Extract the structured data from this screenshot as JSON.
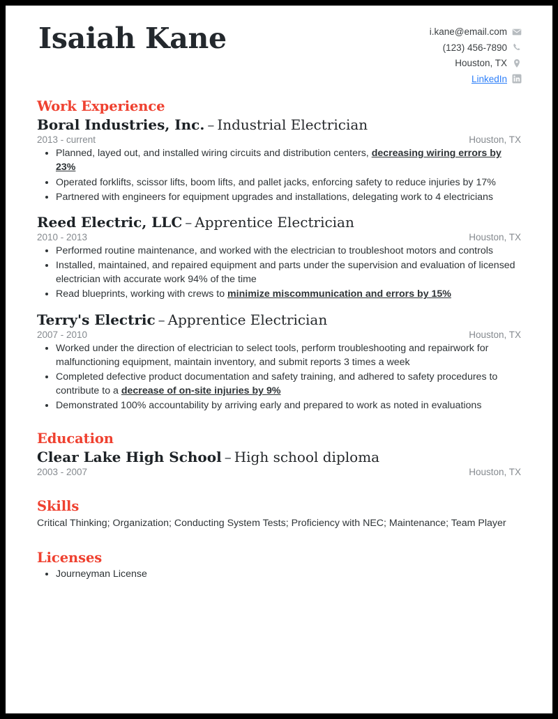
{
  "profile": {
    "name": "Isaiah Kane",
    "contact": [
      {
        "text": "i.kane@email.com",
        "icon": "envelope-icon",
        "link": false
      },
      {
        "text": "(123) 456-7890",
        "icon": "phone-icon",
        "link": false
      },
      {
        "text": "Houston, TX",
        "icon": "location-pin-icon",
        "link": false
      },
      {
        "text": "LinkedIn",
        "icon": "linkedin-icon",
        "link": true
      }
    ]
  },
  "colors": {
    "accent": "#ef4130",
    "link": "#2d7ff9",
    "heading": "#23282d",
    "body": "#2f3437",
    "muted": "#858a8f",
    "border": "#000000"
  },
  "sections": {
    "work": {
      "title": "Work Experience",
      "entries": [
        {
          "org": "Boral Industries, Inc.",
          "separator": "–",
          "role": "Industrial Electrician",
          "dates": "2013 - current",
          "location": "Houston, TX",
          "bullets": [
            {
              "pre": "Planned, layed out, and installed wiring circuits and distribution centers, ",
              "hl": "decreasing wiring errors by 23%",
              "post": ""
            },
            {
              "pre": "Operated forklifts, scissor lifts, boom lifts, and pallet jacks, enforcing safety to reduce injuries by 17%",
              "hl": "",
              "post": ""
            },
            {
              "pre": "Partnered with engineers for equipment upgrades and installations, delegating work to 4 electricians",
              "hl": "",
              "post": ""
            }
          ]
        },
        {
          "org": "Reed Electric, LLC",
          "separator": "–",
          "role": "Apprentice Electrician",
          "dates": "2010 - 2013",
          "location": "Houston, TX",
          "bullets": [
            {
              "pre": "Performed routine maintenance, and worked with the electrician to troubleshoot motors and controls",
              "hl": "",
              "post": ""
            },
            {
              "pre": "Installed, maintained, and repaired equipment and parts under the supervision and evaluation of licensed electrician with accurate work 94% of the time",
              "hl": "",
              "post": ""
            },
            {
              "pre": "Read blueprints, working with crews to ",
              "hl": "minimize miscommunication and errors by 15%",
              "post": ""
            }
          ]
        },
        {
          "org": "Terry's Electric",
          "separator": "–",
          "role": "Apprentice Electrician",
          "dates": "2007 - 2010",
          "location": "Houston, TX",
          "bullets": [
            {
              "pre": "Worked under the direction of electrician to select tools, perform troubleshooting and repairwork for malfunctioning equipment, maintain inventory, and submit reports 3 times a week",
              "hl": "",
              "post": ""
            },
            {
              "pre": "Completed defective product documentation and safety training, and adhered to safety procedures to contribute to a ",
              "hl": "decrease of on-site injuries by 9%",
              "post": ""
            },
            {
              "pre": "Demonstrated 100% accountability by arriving early and prepared to work as noted in evaluations",
              "hl": "",
              "post": ""
            }
          ]
        }
      ]
    },
    "education": {
      "title": "Education",
      "entries": [
        {
          "org": "Clear Lake High School",
          "separator": "–",
          "role": "High school diploma",
          "dates": "2003 - 2007",
          "location": "Houston, TX"
        }
      ]
    },
    "skills": {
      "title": "Skills",
      "text": "Critical Thinking; Organization; Conducting System Tests; Proficiency with NEC; Maintenance; Team Player"
    },
    "licenses": {
      "title": "Licenses",
      "items": [
        "Journeyman License"
      ]
    }
  }
}
